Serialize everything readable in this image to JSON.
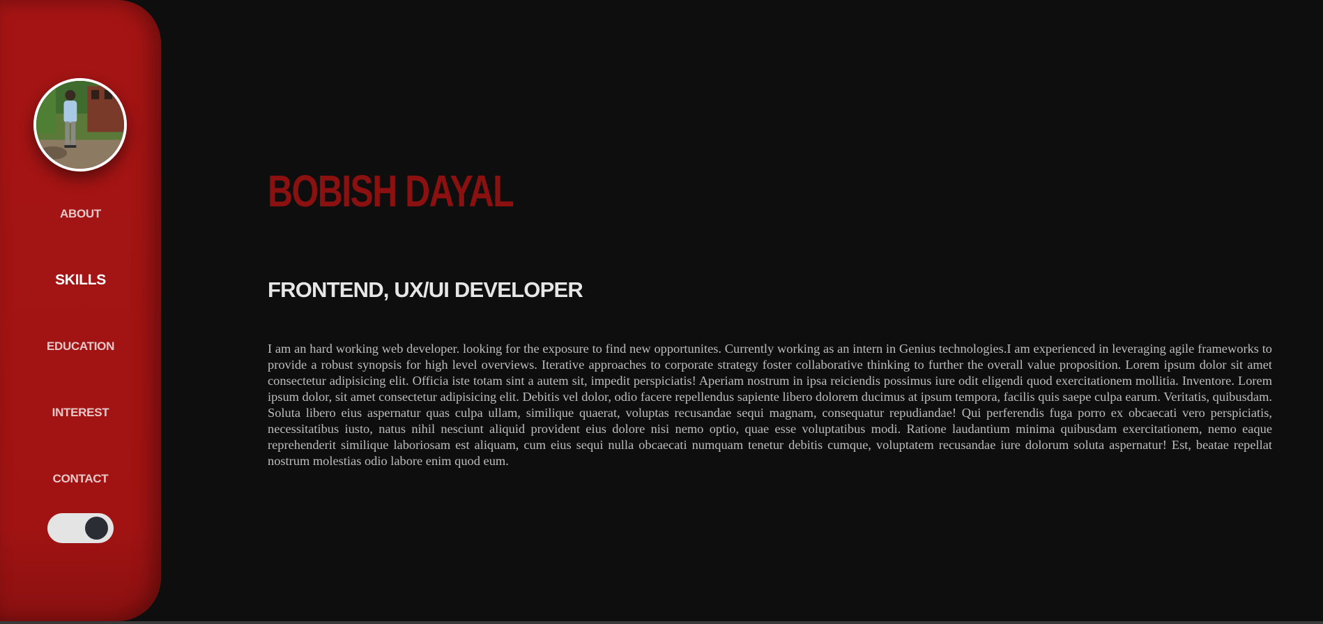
{
  "sidebar": {
    "avatar_alt": "profile photo",
    "items": [
      {
        "label": "ABOUT"
      },
      {
        "label": "SKILLS"
      },
      {
        "label": "EDUCATION"
      },
      {
        "label": "INTEREST"
      },
      {
        "label": "CONTACT"
      }
    ],
    "active_item": "SKILLS",
    "theme_toggle": {
      "state": "on"
    }
  },
  "main": {
    "name": "BOBISH DAYAL",
    "role": "FRONTEND, UX/UI DEVELOPER",
    "bio": "I am an hard working web developer. looking for the exposure to find new opportunites. Currently working as an intern in Genius technologies.I am experienced in leveraging agile frameworks to provide a robust synopsis for high level overviews. Iterative approaches to corporate strategy foster collaborative thinking to further the overall value proposition. Lorem ipsum dolor sit amet consectetur adipisicing elit. Officia iste totam sint a autem sit, impedit perspiciatis! Aperiam nostrum in ipsa reiciendis possimus iure odit eligendi quod exercitationem mollitia. Inventore. Lorem ipsum dolor, sit amet consectetur adipisicing elit. Debitis vel dolor, odio facere repellendus sapiente libero dolorem ducimus at ipsum tempora, facilis quis saepe culpa earum. Veritatis, quibusdam. Soluta libero eius aspernatur quas culpa ullam, similique quaerat, voluptas recusandae sequi magnam, consequatur repudiandae! Qui perferendis fuga porro ex obcaecati vero perspiciatis, necessitatibus iusto, natus nihil nesciunt aliquid provident eius dolore nisi nemo optio, quae esse voluptatibus modi. Ratione laudantium minima quibusdam exercitationem, nemo eaque reprehenderit similique laboriosam est aliquam, cum eius sequi nulla obcaecati numquam tenetur debitis cumque, voluptatem recusandae iure dolorum soluta aspernatur! Est, beatae repellat nostrum molestias odio labore enim quod eum."
  },
  "colors": {
    "sidebar_red": "#a51414",
    "name_red": "#8b1010",
    "background": "#0e0e0e",
    "body_text": "#bdbdbd"
  }
}
